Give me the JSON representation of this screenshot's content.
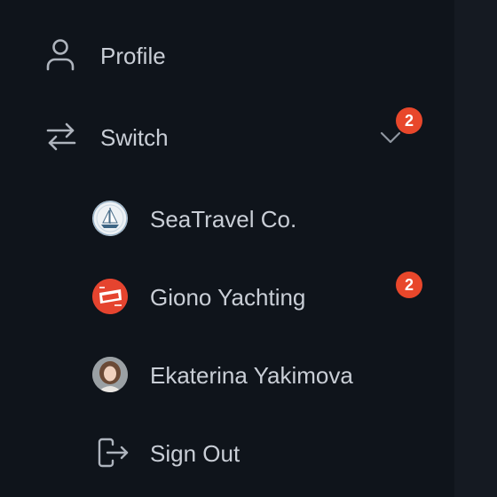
{
  "menu": {
    "profile": {
      "label": "Profile",
      "icon": "user-icon"
    },
    "switch": {
      "label": "Switch",
      "icon": "switch-arrows-icon",
      "badge": "2",
      "expanded": false
    },
    "accounts": [
      {
        "label": "SeaTravel Co.",
        "avatar": "sailboat-logo",
        "badge": ""
      },
      {
        "label": "Giono Yachting",
        "avatar": "red-ribbon-logo",
        "badge": "2"
      },
      {
        "label": "Ekaterina Yakimova",
        "avatar": "person-photo",
        "badge": ""
      }
    ],
    "sign_out": {
      "label": "Sign Out",
      "icon": "sign-out-icon"
    }
  },
  "colors": {
    "background": "#0f141b",
    "text": "#c9ced6",
    "icon": "#aeb4bd",
    "badge": "#e8472b"
  }
}
